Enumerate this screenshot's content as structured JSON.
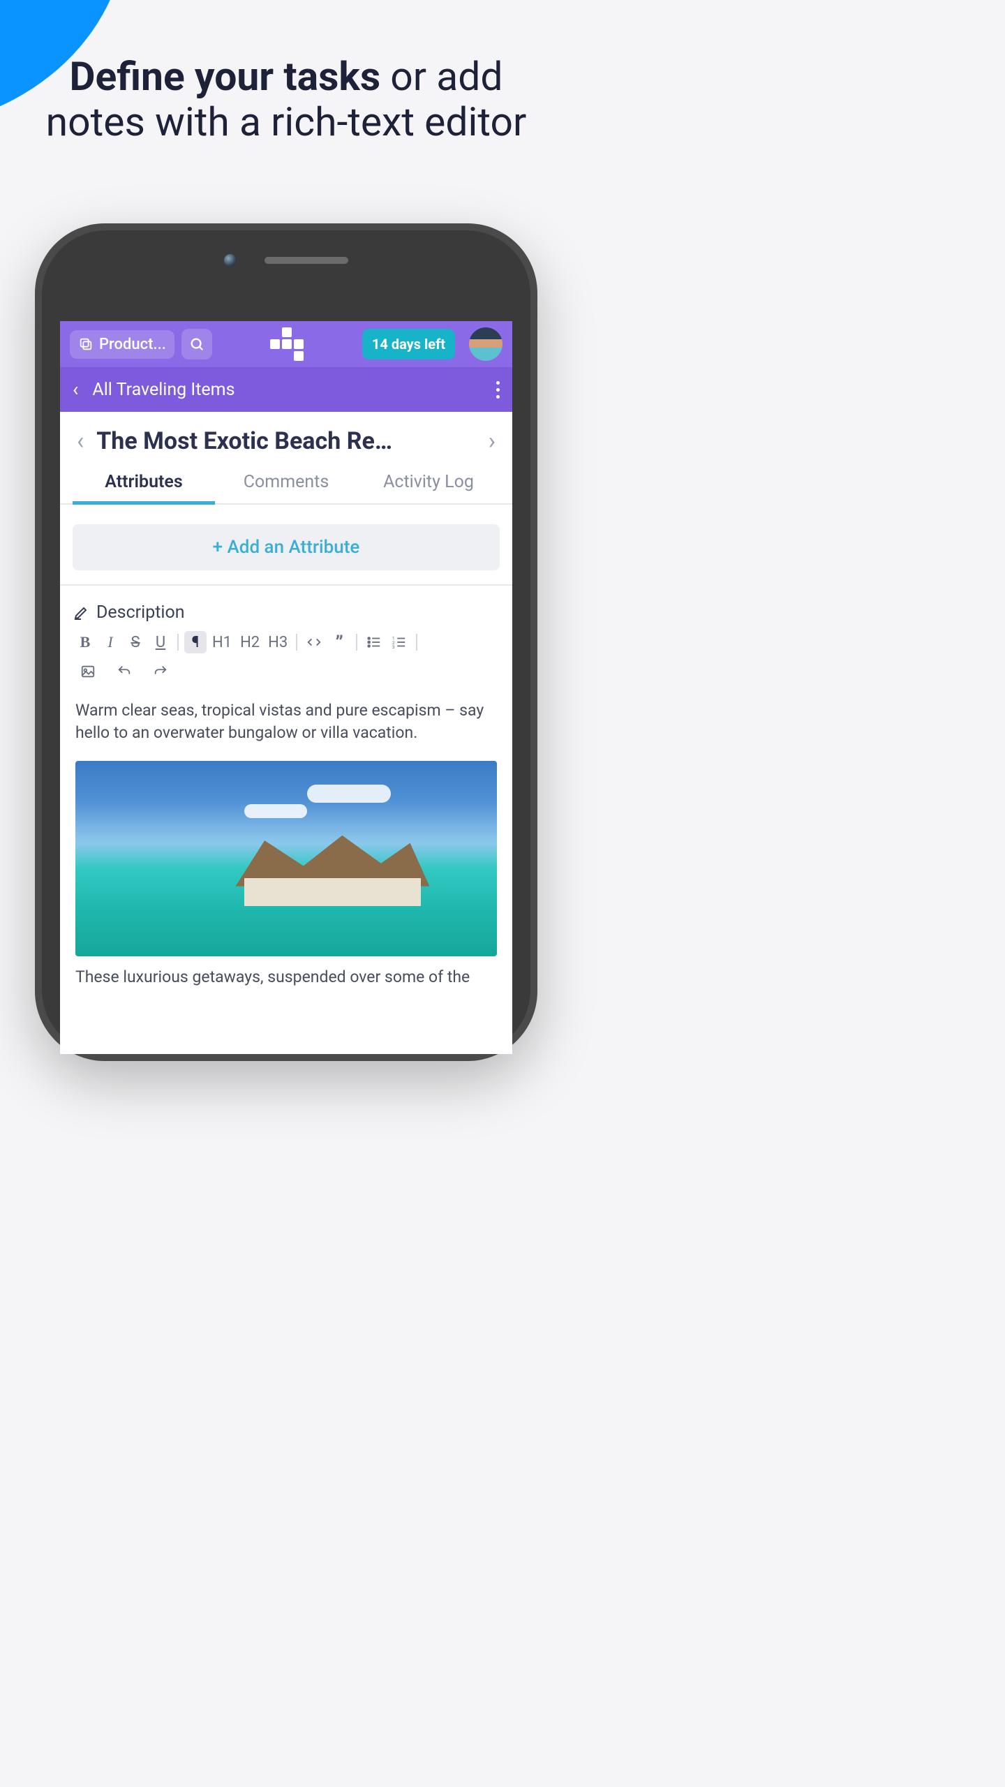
{
  "headline": {
    "bold": "Define your tasks",
    "rest": " or add notes with a rich-text editor"
  },
  "topbar": {
    "project_label": "Product...",
    "trial_label": "14 days left"
  },
  "subbar": {
    "back_label": "All Traveling Items"
  },
  "item": {
    "title": "The Most Exotic Beach Re…"
  },
  "tabs": {
    "attributes": "Attributes",
    "comments": "Comments",
    "activity": "Activity Log"
  },
  "attributes": {
    "add_label": "+  Add an Attribute"
  },
  "description": {
    "label": "Description",
    "body1": "Warm clear seas, tropical vistas and pure escapism – say hello to an overwater bungalow or villa vacation.",
    "body2": "These luxurious getaways, suspended over some of the"
  },
  "toolbar": {
    "bold": "B",
    "italic": "I",
    "strike": "S",
    "underline": "U",
    "paragraph": "¶",
    "h1": "H1",
    "h2": "H2",
    "h3": "H3"
  }
}
